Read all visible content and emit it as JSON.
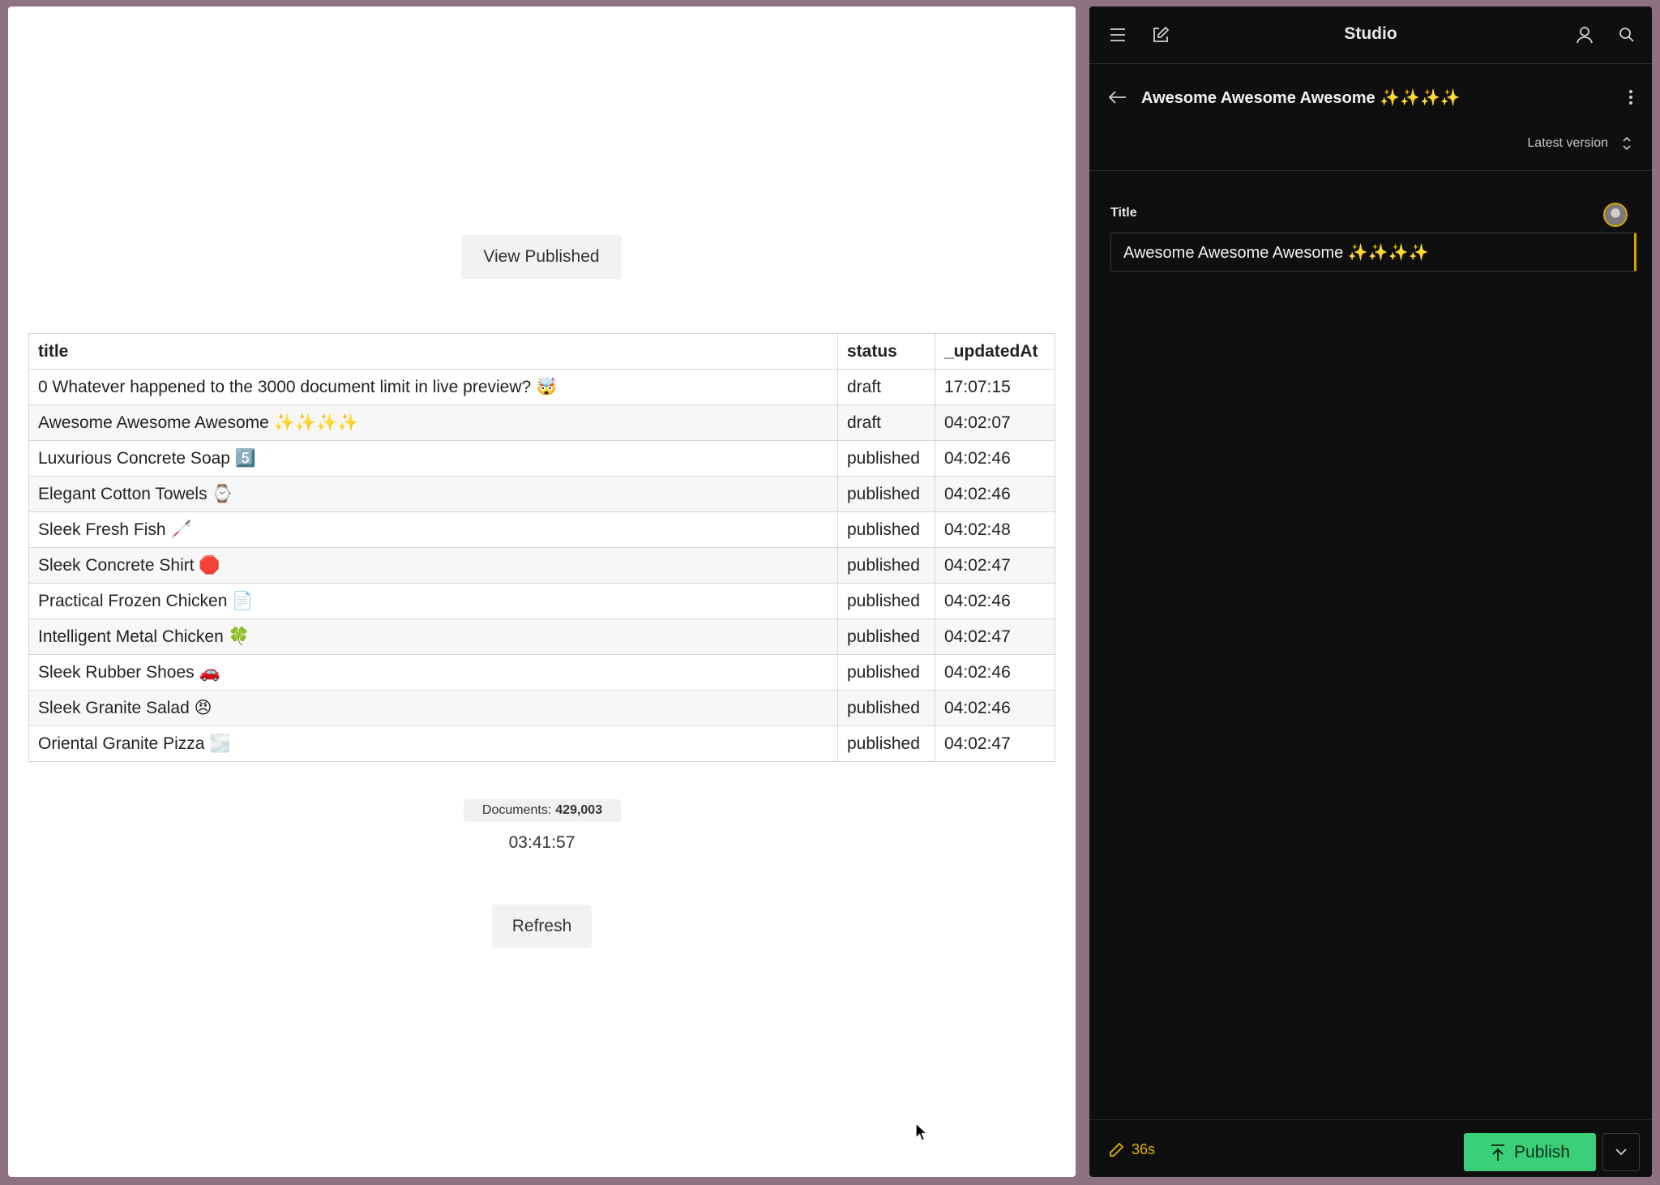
{
  "preview": {
    "view_published_label": "View Published",
    "table": {
      "headers": [
        "title",
        "status",
        "_updatedAt"
      ],
      "rows": [
        {
          "title": "0 Whatever happened to the 3000 document limit in live preview? 🤯",
          "status": "draft",
          "updated": "17:07:15"
        },
        {
          "title": "Awesome Awesome Awesome ✨✨✨✨",
          "status": "draft",
          "updated": "04:02:07"
        },
        {
          "title": "Luxurious Concrete Soap 5️⃣",
          "status": "published",
          "updated": "04:02:46"
        },
        {
          "title": "Elegant Cotton Towels ⌚",
          "status": "published",
          "updated": "04:02:46"
        },
        {
          "title": "Sleek Fresh Fish 🦯",
          "status": "published",
          "updated": "04:02:48"
        },
        {
          "title": "Sleek Concrete Shirt 🛑",
          "status": "published",
          "updated": "04:02:47"
        },
        {
          "title": "Practical Frozen Chicken 📄",
          "status": "published",
          "updated": "04:02:46"
        },
        {
          "title": "Intelligent Metal Chicken 🍀",
          "status": "published",
          "updated": "04:02:47"
        },
        {
          "title": "Sleek Rubber Shoes 🚗",
          "status": "published",
          "updated": "04:02:46"
        },
        {
          "title": "Sleek Granite Salad 😠",
          "status": "published",
          "updated": "04:02:46"
        },
        {
          "title": "Oriental Granite Pizza 🌫️",
          "status": "published",
          "updated": "04:02:47"
        }
      ]
    },
    "documents_label": "Documents:",
    "documents_count": "429,003",
    "clock": "03:41:57",
    "refresh_label": "Refresh"
  },
  "studio": {
    "app_title": "Studio",
    "document_title": "Awesome Awesome Awesome ✨✨✨✨",
    "version_label": "Latest version",
    "field_label": "Title",
    "field_value": "Awesome Awesome Awesome ✨✨✨✨",
    "edit_time": "36s",
    "publish_label": "Publish",
    "icons": {
      "menu": "hamburger-menu-icon",
      "compose": "compose-icon",
      "presence": "users-icon",
      "search": "search-icon",
      "back": "arrow-left-icon",
      "more": "kebab-menu-icon",
      "version": "chevron-updown-icon",
      "edit": "pencil-icon",
      "publish": "publish-arrow-icon",
      "publish_menu": "chevron-down-icon"
    }
  },
  "colors": {
    "studio_bg": "#0f0f0f",
    "publish_green": "#3ad07a",
    "edit_accent": "#e0b200",
    "window_frame": "#8f7282"
  }
}
